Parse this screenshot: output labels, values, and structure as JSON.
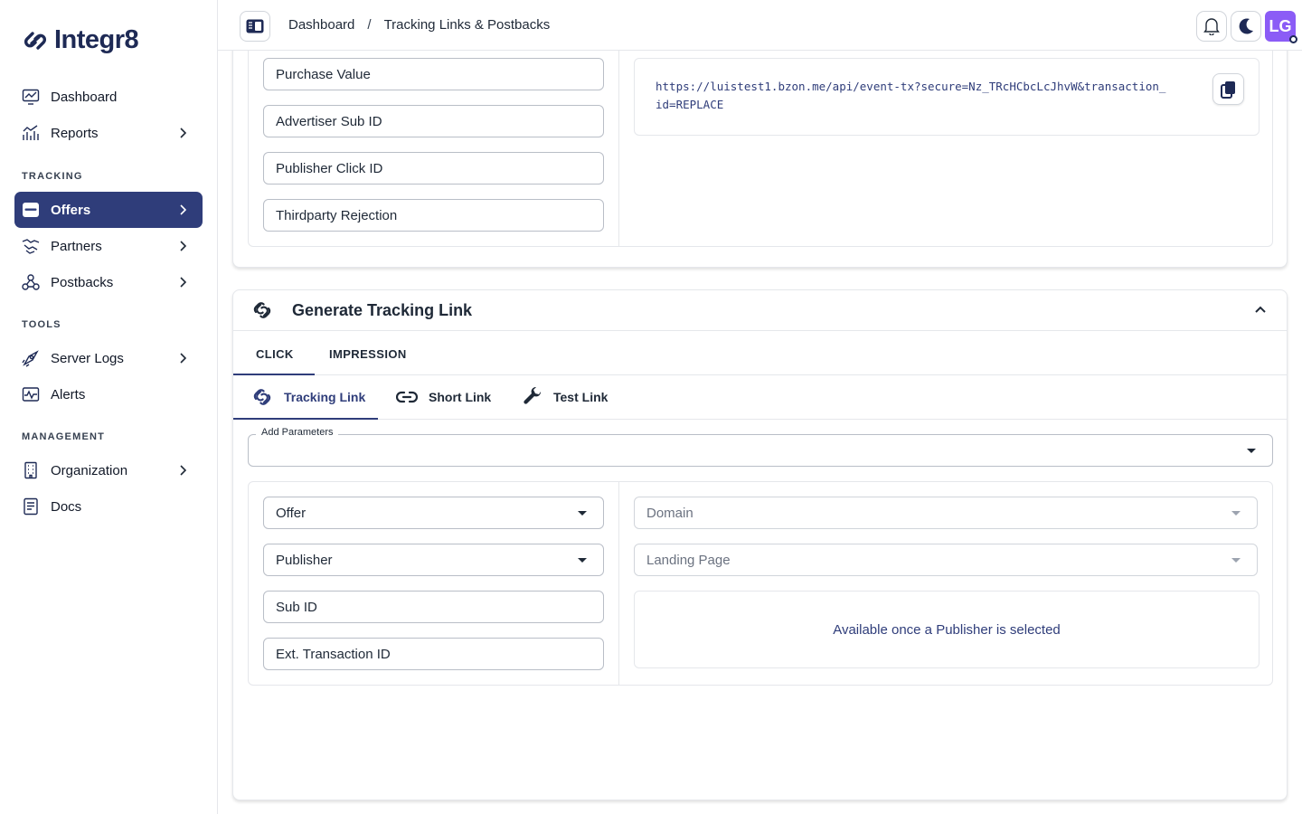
{
  "app": {
    "logo_text": "Integr8"
  },
  "sidebar": {
    "items_top": [
      {
        "label": "Dashboard",
        "icon": "dashboard-icon"
      },
      {
        "label": "Reports",
        "icon": "reports-icon"
      }
    ],
    "section_tracking": "TRACKING",
    "items_tracking": [
      {
        "label": "Offers",
        "icon": "offers-icon",
        "active": true
      },
      {
        "label": "Partners",
        "icon": "partners-icon"
      },
      {
        "label": "Postbacks",
        "icon": "postbacks-icon"
      }
    ],
    "section_tools": "TOOLS",
    "items_tools": [
      {
        "label": "Server Logs",
        "icon": "server-logs-icon"
      },
      {
        "label": "Alerts",
        "icon": "alerts-icon"
      }
    ],
    "section_management": "MANAGEMENT",
    "items_management": [
      {
        "label": "Organization",
        "icon": "organization-icon"
      },
      {
        "label": "Docs",
        "icon": "docs-icon"
      }
    ]
  },
  "header": {
    "breadcrumb": [
      "Dashboard",
      "Tracking Links & Postbacks"
    ],
    "breadcrumb_sep": "/",
    "avatar_initials": "LG"
  },
  "postback_card": {
    "fields": [
      "Purchase Value",
      "Advertiser Sub ID",
      "Publisher Click ID",
      "Thirdparty Rejection"
    ],
    "url": "https://luistest1.bzon.me/api/event-tx?secure=Nz_TRcHCbcLcJhvW&transaction_id=REPLACE",
    "url_line1": "https://luistest1.bzon.me/api/event-tx?secure=Nz_TRcHCbcLcJhvW&transaction_",
    "url_line2": "id=REPLACE"
  },
  "tracking_card": {
    "title": "Generate Tracking Link",
    "tabs": [
      "CLICK",
      "IMPRESSION"
    ],
    "subtabs": [
      "Tracking Link",
      "Short Link",
      "Test Link"
    ],
    "add_parameters_label": "Add Parameters",
    "left_fields": {
      "offer": "Offer",
      "publisher": "Publisher",
      "sub_id": "Sub ID",
      "ext_transaction_id": "Ext. Transaction ID"
    },
    "right_fields": {
      "domain": "Domain",
      "landing_page": "Landing Page"
    },
    "empty_message": "Available once a Publisher is selected"
  },
  "colors": {
    "brand": "#1e2a55",
    "active_nav": "#2f3d7a",
    "avatar": "#8b5cf6"
  }
}
